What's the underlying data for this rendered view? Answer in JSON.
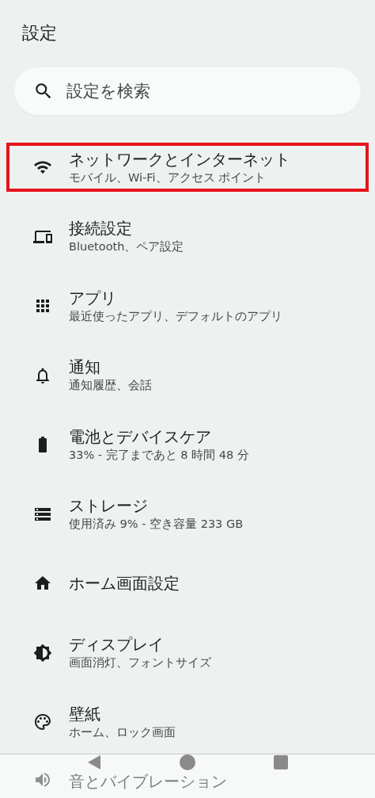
{
  "header": {
    "title": "設定"
  },
  "search": {
    "placeholder": "設定を検索"
  },
  "items": [
    {
      "kind": "wifi",
      "title": "ネットワークとインターネット",
      "subtitle": "モバイル、Wi-Fi、アクセス ポイント",
      "highlighted": true
    },
    {
      "kind": "devices",
      "title": "接続設定",
      "subtitle": "Bluetooth、ペア設定",
      "highlighted": false
    },
    {
      "kind": "apps",
      "title": "アプリ",
      "subtitle": "最近使ったアプリ、デフォルトのアプリ",
      "highlighted": false
    },
    {
      "kind": "bell",
      "title": "通知",
      "subtitle": "通知履歴、会話",
      "highlighted": false
    },
    {
      "kind": "battery",
      "title": "電池とデバイスケア",
      "subtitle": "33% - 完了まであと 8 時間 48 分",
      "highlighted": false
    },
    {
      "kind": "storage",
      "title": "ストレージ",
      "subtitle": "使用済み 9% - 空き容量 233 GB",
      "highlighted": false
    },
    {
      "kind": "home",
      "title": "ホーム画面設定",
      "highlighted": false
    },
    {
      "kind": "display",
      "title": "ディスプレイ",
      "subtitle": "画面消灯、フォントサイズ",
      "highlighted": false
    },
    {
      "kind": "palette",
      "title": "壁紙",
      "subtitle": "ホーム、ロック画面",
      "highlighted": false
    },
    {
      "kind": "sound",
      "title": "音とバイブレーション",
      "highlighted": false
    }
  ]
}
